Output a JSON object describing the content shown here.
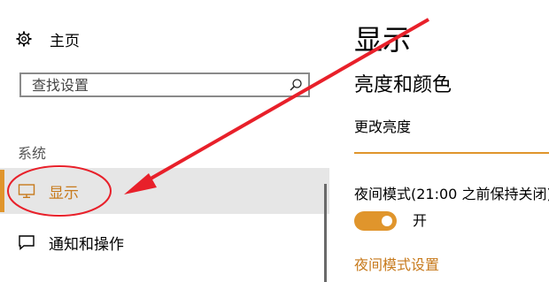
{
  "sidebar": {
    "home_label": "主页",
    "search_placeholder": "查找设置",
    "section_title": "系统",
    "items": [
      {
        "label": "显示",
        "icon": "monitor-icon",
        "active": true
      },
      {
        "label": "通知和操作",
        "icon": "notification-icon",
        "active": false
      }
    ]
  },
  "main": {
    "title": "显示",
    "subheading": "亮度和颜色",
    "brightness_label": "更改亮度",
    "night_mode_label": "夜间模式(21:00 之前保持关闭)",
    "toggle_state_label": "开",
    "night_mode_settings_link": "夜间模式设置"
  },
  "colors": {
    "accent": "#e0952c",
    "annotation_red": "#e8202a"
  }
}
